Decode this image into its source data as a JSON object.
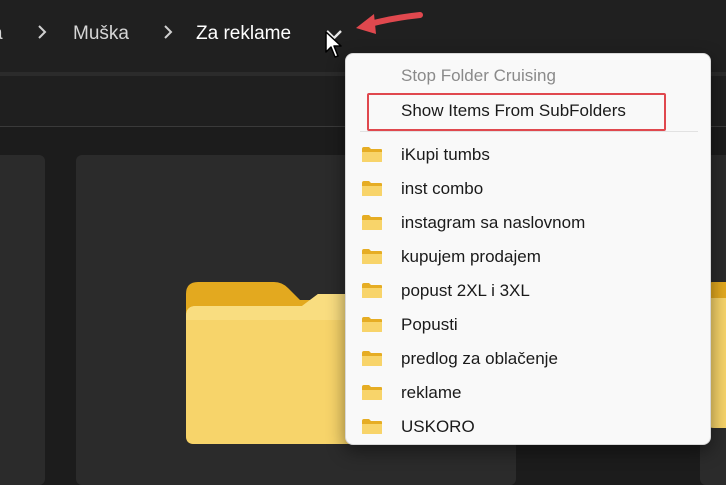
{
  "breadcrumb": {
    "partial_label": "a",
    "items": [
      "Muška",
      "Za reklame"
    ]
  },
  "menu": {
    "commands": {
      "stop_cruising": "Stop Folder Cruising",
      "show_subfolders": "Show Items From SubFolders"
    },
    "folders": [
      "iKupi tumbs",
      "inst combo",
      "instagram sa naslovnom",
      "kupujem prodajem",
      "popust 2XL i 3XL",
      "Popusti",
      "predlog za oblačenje",
      "reklame",
      "USKORO"
    ]
  },
  "colors": {
    "window_bg": "#1c1c1c",
    "menu_bg": "#f9f9f9",
    "annotation_red": "#e0484e",
    "folder_yellow": "#f5c542"
  },
  "icons": {
    "breadcrumb_separator": "chevron-right-icon",
    "dropdown_toggle": "chevron-down-icon",
    "folder": "folder-icon",
    "pointer": "mouse-pointer-icon",
    "annotation": "red-arrow-annotation"
  }
}
